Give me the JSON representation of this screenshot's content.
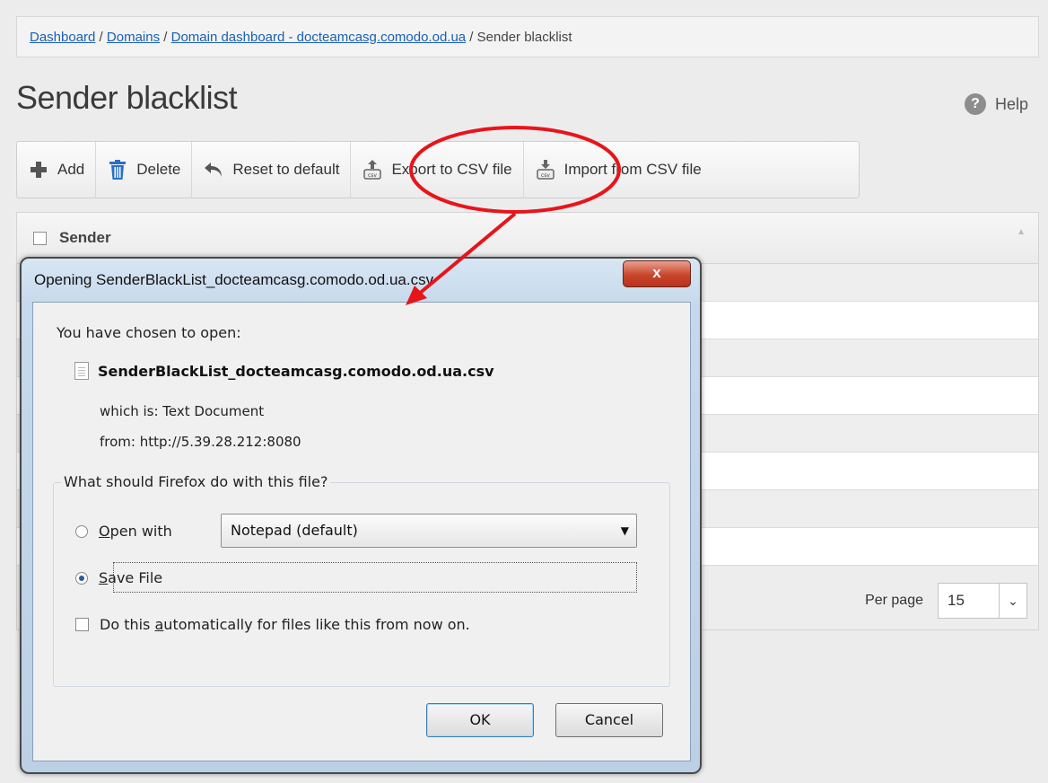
{
  "breadcrumb": {
    "items": [
      "Dashboard",
      "Domains",
      "Domain dashboard - docteamcasg.comodo.od.ua"
    ],
    "separator": " / ",
    "current": "Sender blacklist"
  },
  "page": {
    "title": "Sender blacklist",
    "help_label": "Help",
    "help_icon": "?"
  },
  "toolbar": {
    "add": "Add",
    "delete": "Delete",
    "reset": "Reset to default",
    "export": "Export to CSV file",
    "import": "Import from CSV file"
  },
  "table": {
    "header": "Sender",
    "per_page_label": "Per page",
    "per_page_value": "15"
  },
  "dialog": {
    "title": "Opening SenderBlackList_docteamcasg.comodo.od.ua.csv",
    "close": "x",
    "chosen": "You have chosen to open:",
    "filename": "SenderBlackList_docteamcasg.comodo.od.ua.csv",
    "which_is_label": "which is:",
    "which_is_value": "Text Document",
    "from_label": "from:",
    "from_value": "http://5.39.28.212:8080",
    "question": "What should Firefox do with this file?",
    "open_with_u": "O",
    "open_with_rest": "pen with",
    "app": "Notepad (default)",
    "save_u": "S",
    "save_rest": "ave File",
    "auto_before": "Do this ",
    "auto_u": "a",
    "auto_after": "utomatically for files like this from now on.",
    "ok": "OK",
    "cancel": "Cancel"
  },
  "colors": {
    "annotation": "#e8141b",
    "link": "#1a5fb4",
    "dialog_frame": "#bcd0e5"
  }
}
